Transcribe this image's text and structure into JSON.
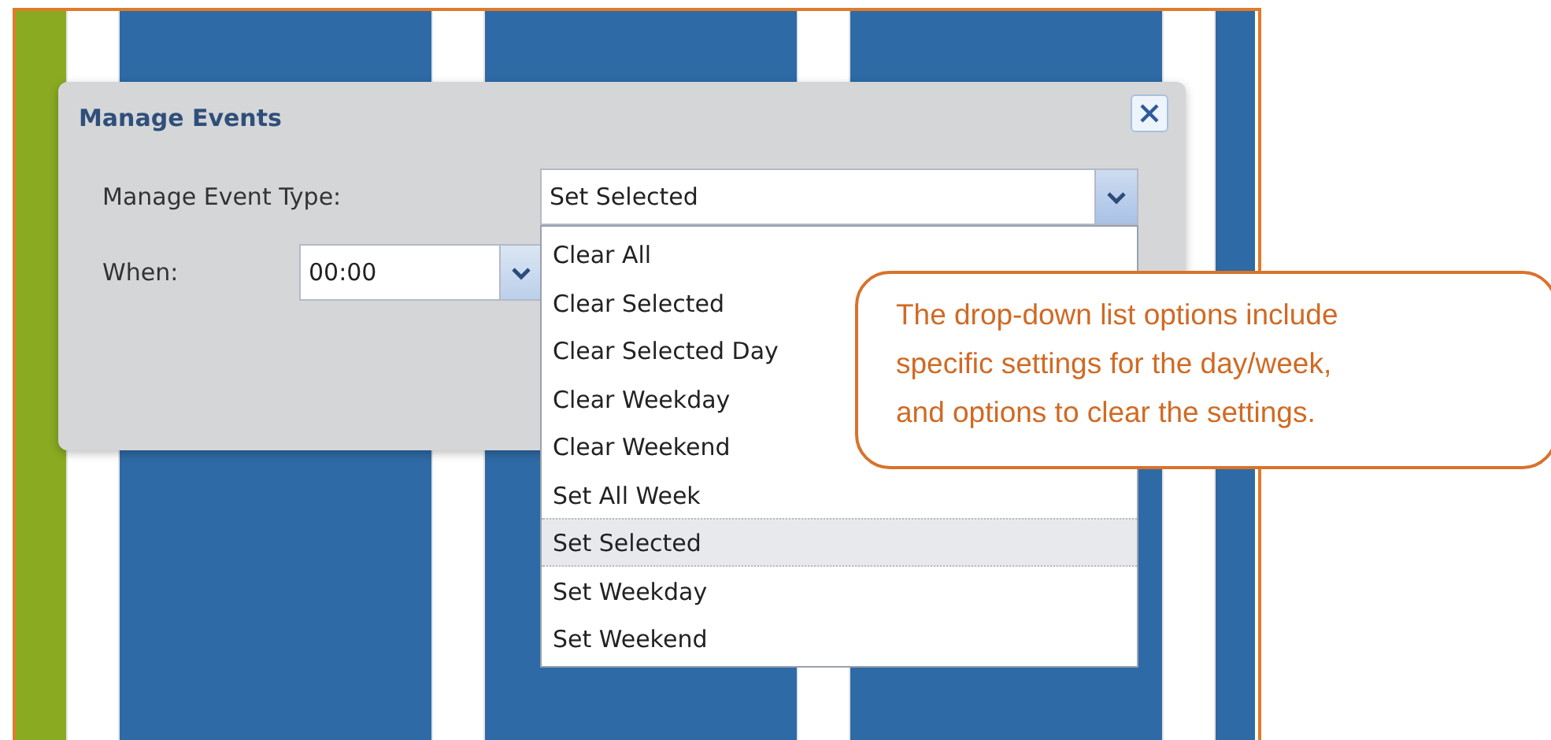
{
  "dialog": {
    "title": "Manage Events",
    "fields": [
      {
        "label": "Manage Event Type:",
        "value": "Set Selected",
        "open": true
      },
      {
        "label": "When:",
        "value": "00:00",
        "open": false
      }
    ]
  },
  "dropdown_options": [
    {
      "label": "Clear All",
      "selected": false
    },
    {
      "label": "Clear Selected",
      "selected": false
    },
    {
      "label": "Clear Selected Day",
      "selected": false
    },
    {
      "label": "Clear Weekday",
      "selected": false
    },
    {
      "label": "Clear Weekend",
      "selected": false
    },
    {
      "label": "Set All Week",
      "selected": false
    },
    {
      "label": "Set Selected",
      "selected": true
    },
    {
      "label": "Set Weekday",
      "selected": false
    },
    {
      "label": "Set Weekend",
      "selected": false
    }
  ],
  "callout": {
    "lines": [
      "The drop-down list options include",
      "specific settings for the day/week,",
      "and options to clear the settings."
    ]
  }
}
